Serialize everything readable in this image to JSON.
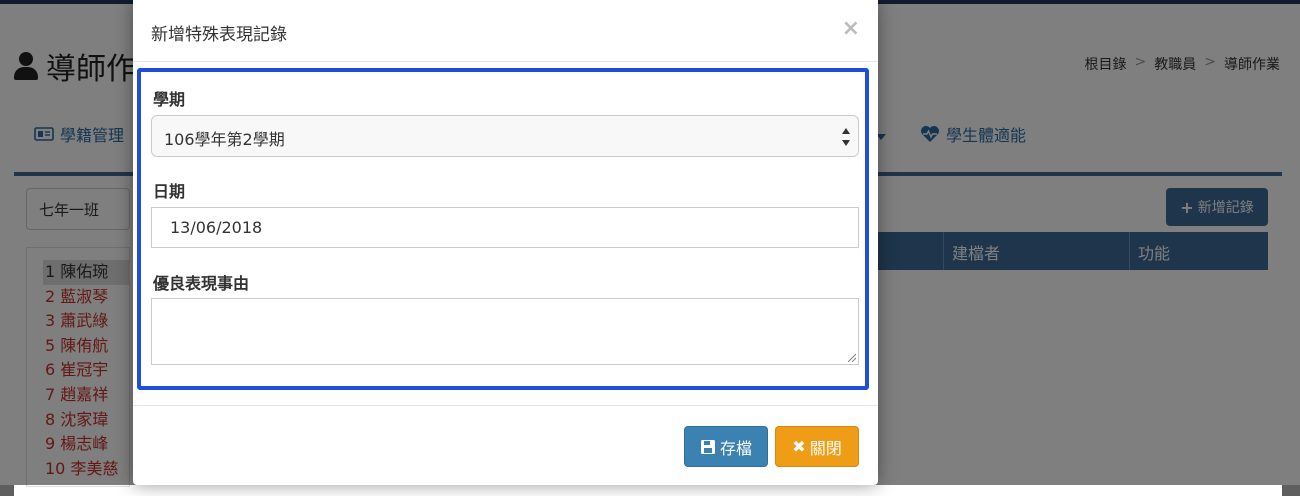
{
  "page": {
    "title": "導師作",
    "breadcrumb": [
      "根目錄",
      "教職員",
      "導師作業"
    ],
    "breadcrumb_sep": ">",
    "tabs": {
      "student_records": "學籍管理",
      "fitness": "學生體適能"
    },
    "class_select": "七年一班",
    "students": [
      "1 陳佑琬",
      "2 藍淑琴",
      "3 蕭武綠",
      "5 陳侑航",
      "6 崔冠宇",
      "7 趙嘉祥",
      "8 沈家瑋",
      "9 楊志峰",
      "10 李美慈"
    ],
    "add_record_button": "新增記錄",
    "table_headers": {
      "creator": "建檔者",
      "function": "功能"
    }
  },
  "modal": {
    "title": "新增特殊表現記錄",
    "close_symbol": "×",
    "semester": {
      "label": "學期",
      "value": "106學年第2學期"
    },
    "date": {
      "label": "日期",
      "value": "13/06/2018"
    },
    "reason": {
      "label": "優良表現事由",
      "value": ""
    },
    "save_button": "存檔",
    "close_button": "關閉"
  },
  "colors": {
    "highlight_border": "#1f4fd8",
    "save_button": "#3b82b3",
    "close_button": "#ef9c17",
    "primary_dark": "#3c6b96",
    "student_red": "#c9302c"
  }
}
